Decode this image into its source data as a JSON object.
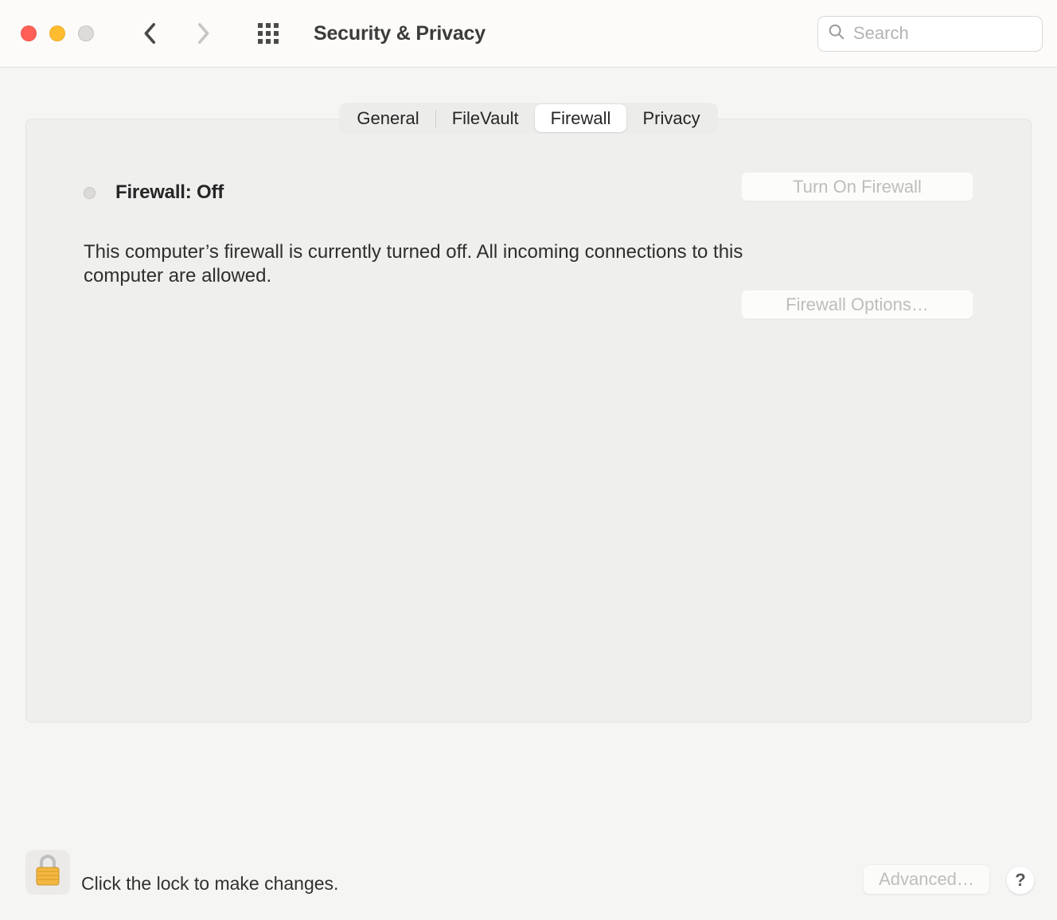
{
  "toolbar": {
    "title": "Security & Privacy",
    "search_placeholder": "Search"
  },
  "tabs": {
    "general": "General",
    "filevault": "FileVault",
    "firewall": "Firewall",
    "privacy": "Privacy",
    "active": "firewall"
  },
  "firewall": {
    "status_label": "Firewall: Off",
    "status_description": "This computer’s firewall is currently turned off. All incoming connections to this computer are allowed.",
    "turn_on_label": "Turn On Firewall",
    "options_label": "Firewall Options…"
  },
  "footer": {
    "lock_hint": "Click the lock to make changes.",
    "advanced_label": "Advanced…",
    "help_label": "?"
  }
}
